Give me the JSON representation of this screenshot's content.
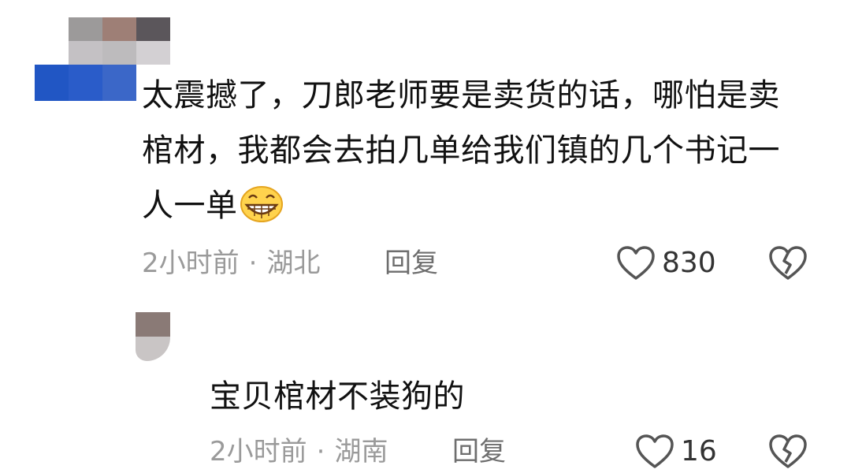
{
  "colors": {
    "text": "#111111",
    "meta": "#9a9a9a",
    "icon": "#555555"
  },
  "comment": {
    "avatar_tiles": [
      "#ffffff",
      "#9c9a9a",
      "#9e7f76",
      "#5b565b",
      "#ffffff",
      "#c4c1c4",
      "#bdbbbd",
      "#d3d0d3",
      "#2156c4",
      "#2a5cc9",
      "#3b67c8",
      "#ffffff"
    ],
    "text": "太震撼了，刀郎老师要是卖货的话，哪怕是卖棺材，我都会去拍几单给我们镇的几个书记一人一单",
    "emoji_icon": "grinning-face-icon",
    "time": "2小时前",
    "separator": "·",
    "location": "湖北",
    "reply_label": "回复",
    "like_count": "830"
  },
  "reply": {
    "avatar_tiles": [
      "#8a7a76",
      "#c9c5c5"
    ],
    "text": "宝贝棺材不装狗的",
    "time": "2小时前",
    "separator": "·",
    "location": "湖南",
    "reply_label": "回复",
    "like_count": "16"
  }
}
